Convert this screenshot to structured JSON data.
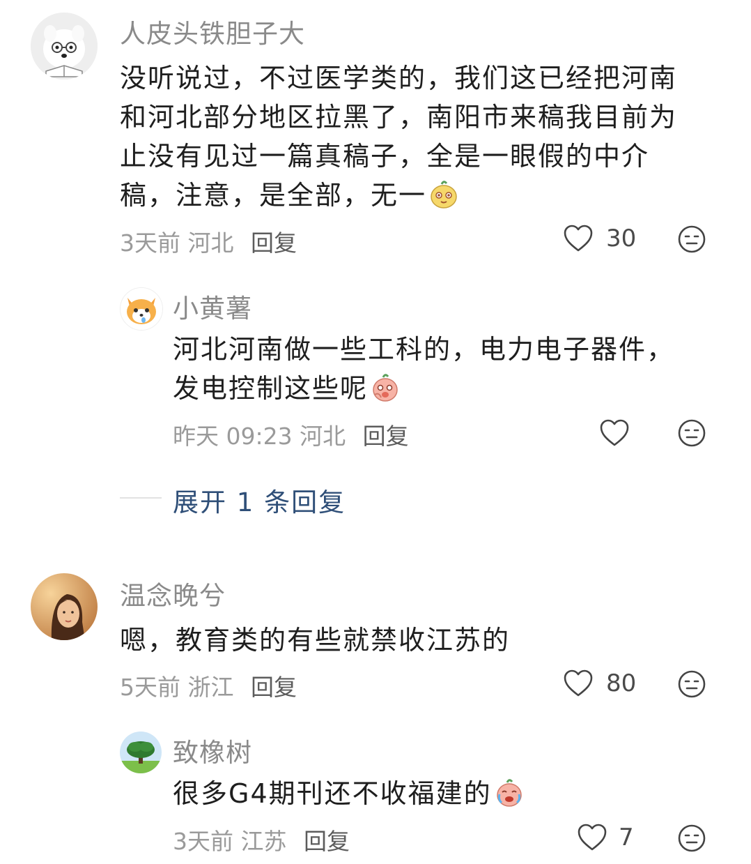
{
  "comments": [
    {
      "name": "人皮头铁胆子大",
      "text_lines": [
        "没听说过，不过医学类的，我们这已经把河南",
        "和河北部分地区拉黑了，南阳市来稿我目前为",
        "止没有见过一篇真稿子，全是一眼假的中介",
        "稿，注意，是全部，无一"
      ],
      "time": "3天前",
      "location": "河北",
      "reply_label": "回复",
      "likes": "30",
      "replies": [
        {
          "name": "小黄薯",
          "text_lines": [
            "河北河南做一些工科的，电力电子器件，",
            "发电控制这些呢"
          ],
          "time": "昨天 09:23",
          "location": "河北",
          "reply_label": "回复",
          "likes": ""
        }
      ],
      "expand_label": "展开 1 条回复"
    },
    {
      "name": "温念晚兮",
      "text_lines": [
        "嗯，教育类的有些就禁收江苏的"
      ],
      "time": "5天前",
      "location": "浙江",
      "reply_label": "回复",
      "likes": "80",
      "replies": [
        {
          "name": "致橡树",
          "text_lines": [
            "很多G4期刊还不收福建的"
          ],
          "time": "3天前",
          "location": "江苏",
          "reply_label": "回复",
          "likes": "7"
        }
      ]
    }
  ],
  "icons": {
    "like": "heart-outline-icon",
    "dislike": "meh-face-icon"
  },
  "colors": {
    "name": "#8a8a8a",
    "meta": "#9a9a9a",
    "expand": "#2f4f78"
  }
}
